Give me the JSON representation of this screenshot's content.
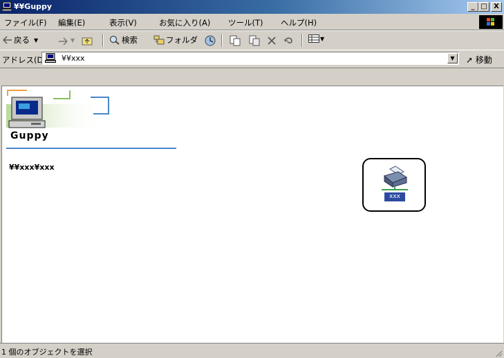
{
  "window": {
    "title": "¥¥Guppy"
  },
  "title_buttons": {
    "minimize": "_",
    "maximize": "□",
    "close": "X"
  },
  "menu": [
    "ファイル(F)",
    "編集(E)",
    "表示(V)",
    "お気に入り(A)",
    "ツール(T)",
    "ヘルプ(H)"
  ],
  "toolbar": {
    "back": "戻る",
    "search": "検索",
    "folders": "フォルダ"
  },
  "address": {
    "label": "アドレス(D)",
    "value": "¥¥xxx",
    "go": "移動"
  },
  "content": {
    "folder_title": "Guppy",
    "path": "¥¥xxx¥xxx",
    "printer_label": "xxx"
  },
  "status": {
    "text": "1 個のオブジェクトを選択"
  },
  "colors": {
    "titlebar": "#0a246a",
    "accent": "#4a86c8",
    "selection": "#2c4aa0"
  }
}
